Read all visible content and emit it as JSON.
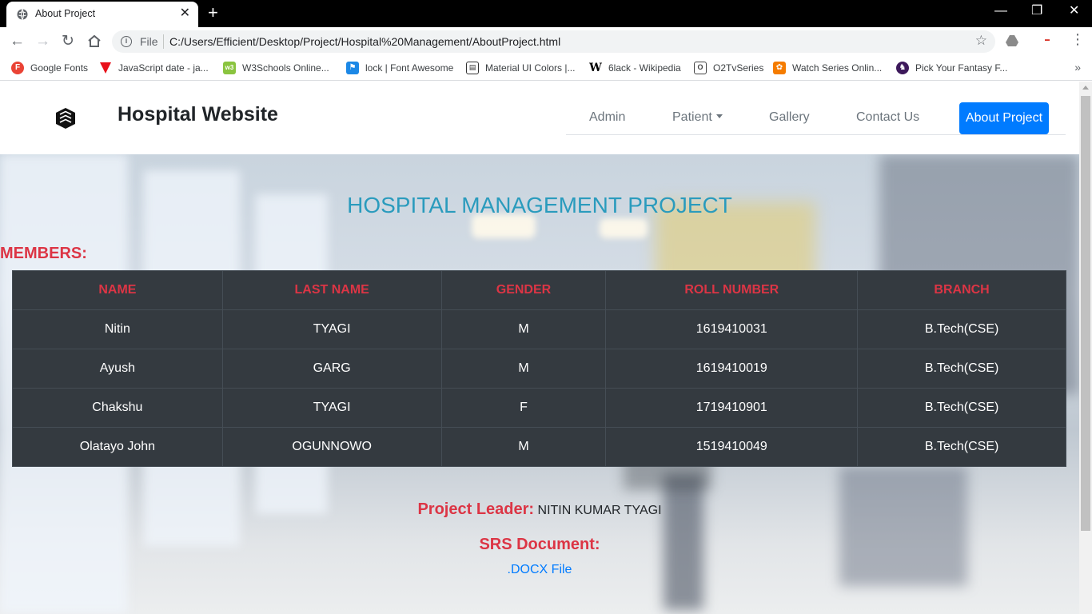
{
  "browser": {
    "tab_title": "About Project",
    "url_scheme": "File",
    "url": "C:/Users/Efficient/Desktop/Project/Hospital%20Management/AboutProject.html",
    "bookmarks": [
      {
        "label": "Google Fonts",
        "icon": "google-fonts-icon",
        "color": "#ea4335"
      },
      {
        "label": "JavaScript date - ja...",
        "icon": "javascript-icon",
        "color": "#e8101a"
      },
      {
        "label": "W3Schools Online...",
        "icon": "w3schools-icon",
        "color": "#8ac43f"
      },
      {
        "label": "lock | Font Awesome",
        "icon": "font-awesome-icon",
        "color": "#1c88e6"
      },
      {
        "label": "Material UI Colors |...",
        "icon": "material-ui-icon",
        "color": "#333333"
      },
      {
        "label": "6lack - Wikipedia",
        "icon": "wikipedia-icon",
        "color": "#000000"
      },
      {
        "label": "O2TvSeries",
        "icon": "o2tvseries-icon",
        "color": "#444444"
      },
      {
        "label": "Watch Series Onlin...",
        "icon": "watch-series-icon",
        "color": "#f57c00"
      },
      {
        "label": "Pick Your Fantasy F...",
        "icon": "fantasy-icon",
        "color": "#3d195b"
      }
    ]
  },
  "navbar": {
    "brand": "Hospital Website",
    "items": {
      "admin": "Admin",
      "patient": "Patient",
      "gallery": "Gallery",
      "contact": "Contact Us",
      "about": "About Project"
    }
  },
  "main": {
    "title": "HOSPITAL MANAGEMENT PROJECT",
    "members_heading": "MEMBERS:",
    "table": {
      "headers": [
        "NAME",
        "LAST NAME",
        "GENDER",
        "ROLL NUMBER",
        "BRANCH"
      ],
      "rows": [
        [
          "Nitin",
          "TYAGI",
          "M",
          "1619410031",
          "B.Tech(CSE)"
        ],
        [
          "Ayush",
          "GARG",
          "M",
          "1619410019",
          "B.Tech(CSE)"
        ],
        [
          "Chakshu",
          "TYAGI",
          "F",
          "1719410901",
          "B.Tech(CSE)"
        ],
        [
          "Olatayo John",
          "OGUNNOWO",
          "M",
          "1519410049",
          "B.Tech(CSE)"
        ]
      ]
    },
    "leader_label": "Project Leader:",
    "leader_name": "NITIN KUMAR TYAGI",
    "srs_label": "SRS Document:",
    "srs_link": ".DOCX File"
  },
  "colors": {
    "accent": "#dc3545",
    "title": "#2a9bbd",
    "primary": "#007bff",
    "table_bg": "#343a40"
  }
}
